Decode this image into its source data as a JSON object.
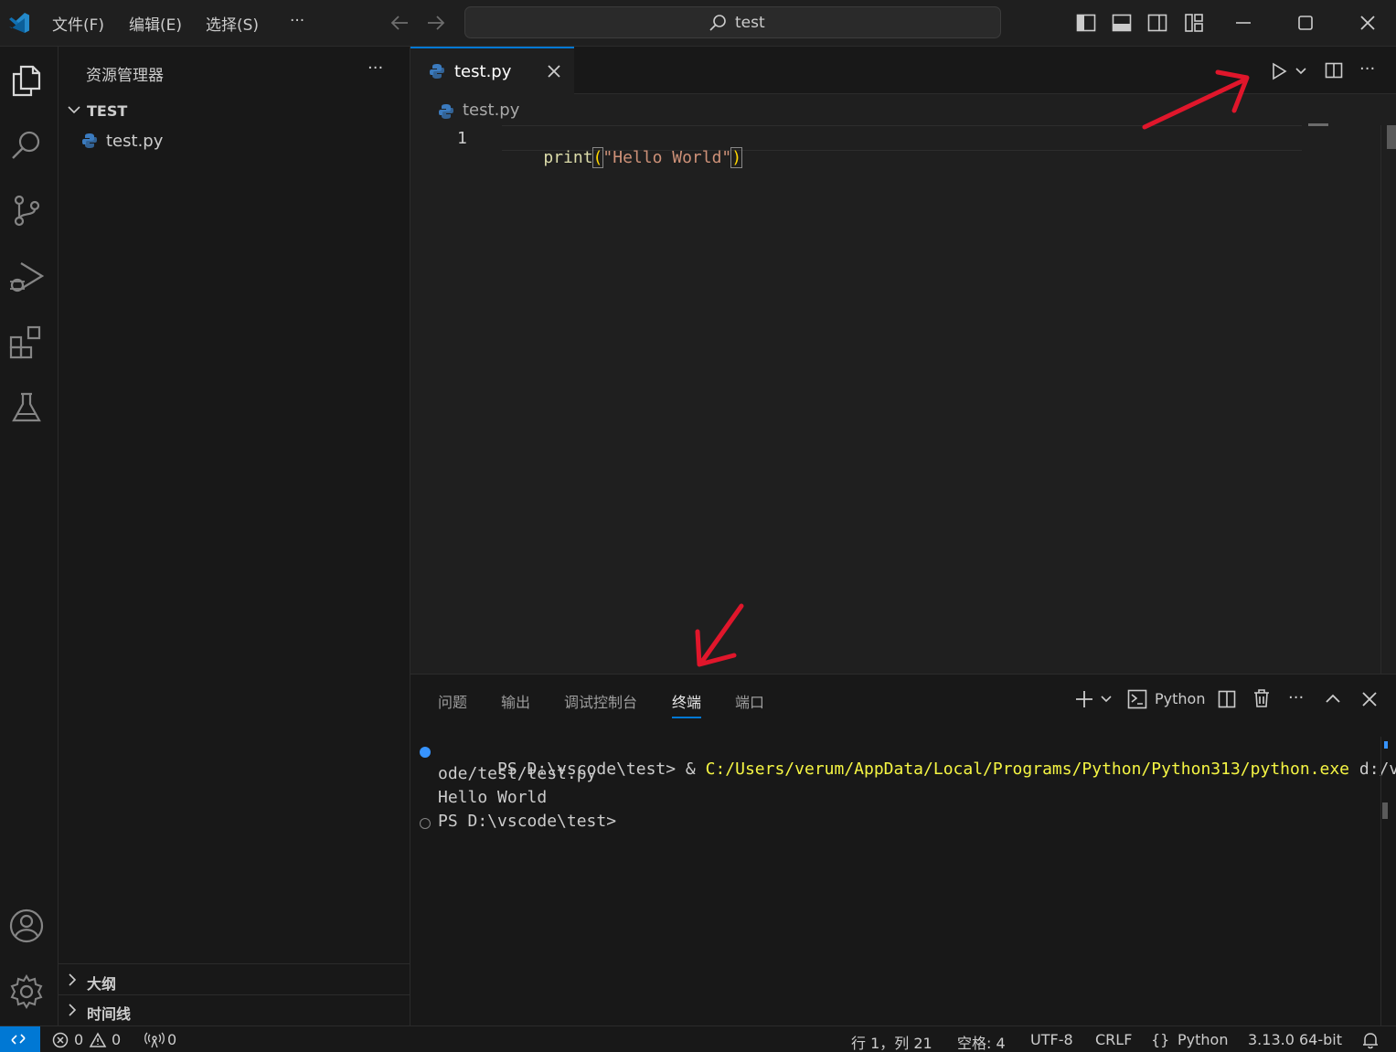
{
  "titlebar": {
    "menus": [
      "文件(F)",
      "编辑(E)",
      "选择(S)",
      "···"
    ],
    "search_text": "test"
  },
  "sidebar": {
    "title": "资源管理器",
    "folder": "TEST",
    "file": "test.py",
    "outline": "大纲",
    "timeline": "时间线"
  },
  "editor": {
    "tab_label": "test.py",
    "breadcrumb": "test.py",
    "line_number": "1",
    "code_fn": "print",
    "code_open": "(",
    "code_str": "\"Hello World\"",
    "code_close": ")"
  },
  "panel": {
    "tabs": [
      "问题",
      "输出",
      "调试控制台",
      "终端",
      "端口"
    ],
    "active_tab": "终端",
    "shell_label": "Python",
    "terminal": {
      "prompt1": "PS D:\\vscode\\test> & ",
      "cmd_path": "C:/Users/verum/AppData/Local/Programs/Python/Python313/python.exe",
      "cmd_arg1": " d:/vsc",
      "cmd_arg2": "ode/test/test.py",
      "output": "Hello World",
      "prompt2": "PS D:\\vscode\\test>"
    }
  },
  "statusbar": {
    "errors": "0",
    "warnings": "0",
    "ports": "0",
    "position": "行 1，列 21",
    "spaces": "空格: 4",
    "encoding": "UTF-8",
    "eol": "CRLF",
    "language": "Python",
    "interpreter": "3.13.0 64-bit"
  },
  "colors": {
    "accent": "#0078d4",
    "annotation_arrow": "#e0162b",
    "string": "#ce9178",
    "function": "#dcdcaa",
    "terminal_path": "#f5f543"
  }
}
